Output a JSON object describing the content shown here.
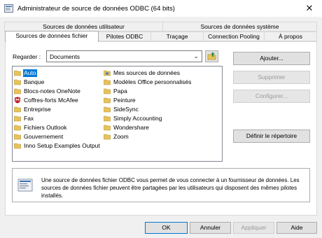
{
  "window": {
    "title": "Administrateur de source de données ODBC (64 bits)",
    "close_glyph": "✕"
  },
  "tabs_back": [
    {
      "label": "Sources de données utilisateur"
    },
    {
      "label": "Sources de données système"
    }
  ],
  "tabs_front": [
    {
      "label": "Sources de données fichier"
    },
    {
      "label": "Pilotes ODBC"
    },
    {
      "label": "Traçage"
    },
    {
      "label": "Connection Pooling"
    },
    {
      "label": "À propos"
    }
  ],
  "look_in": {
    "label": "Regarder :",
    "value": "Documents"
  },
  "files_col1": [
    {
      "label": "Auto",
      "icon": "folder-icon",
      "selected": true
    },
    {
      "label": "Banque",
      "icon": "folder-icon"
    },
    {
      "label": "Blocs-notes OneNote",
      "icon": "folder-icon"
    },
    {
      "label": "Coffres-forts McAfee",
      "icon": "mcafee-icon"
    },
    {
      "label": "Entreprise",
      "icon": "folder-icon"
    },
    {
      "label": "Fax",
      "icon": "folder-icon"
    },
    {
      "label": "Fichiers Outlook",
      "icon": "folder-icon"
    },
    {
      "label": "Gouvernement",
      "icon": "folder-icon"
    },
    {
      "label": "Inno Setup Examples Output",
      "icon": "folder-icon"
    }
  ],
  "files_col2": [
    {
      "label": "Mes sources de données",
      "icon": "data-folder-icon"
    },
    {
      "label": "Modèles Office personnalisés",
      "icon": "folder-icon"
    },
    {
      "label": "Papa",
      "icon": "folder-icon"
    },
    {
      "label": "Peinture",
      "icon": "folder-icon"
    },
    {
      "label": "SideSync",
      "icon": "folder-icon"
    },
    {
      "label": "Simply Accounting",
      "icon": "folder-icon"
    },
    {
      "label": "Wondershare",
      "icon": "folder-icon"
    },
    {
      "label": "Zoom",
      "icon": "folder-icon"
    }
  ],
  "side_buttons": {
    "add": "Ajouter...",
    "remove": "Supprimer",
    "configure": "Configurer...",
    "set_dir": "Définir le répertoire"
  },
  "info_text": "Une source de données fichier ODBC vous permet de vous connecter à un fournisseur de données. Les sources de données fichier peuvent être partagées par les utilisateurs qui disposent des mêmes pilotes installés.",
  "bottom_buttons": {
    "ok": "OK",
    "cancel": "Annuler",
    "apply": "Appliquer",
    "help": "Aide"
  },
  "colors": {
    "selection": "#0078d7",
    "folder": "#e8c25a",
    "mcafee": "#c01818"
  }
}
